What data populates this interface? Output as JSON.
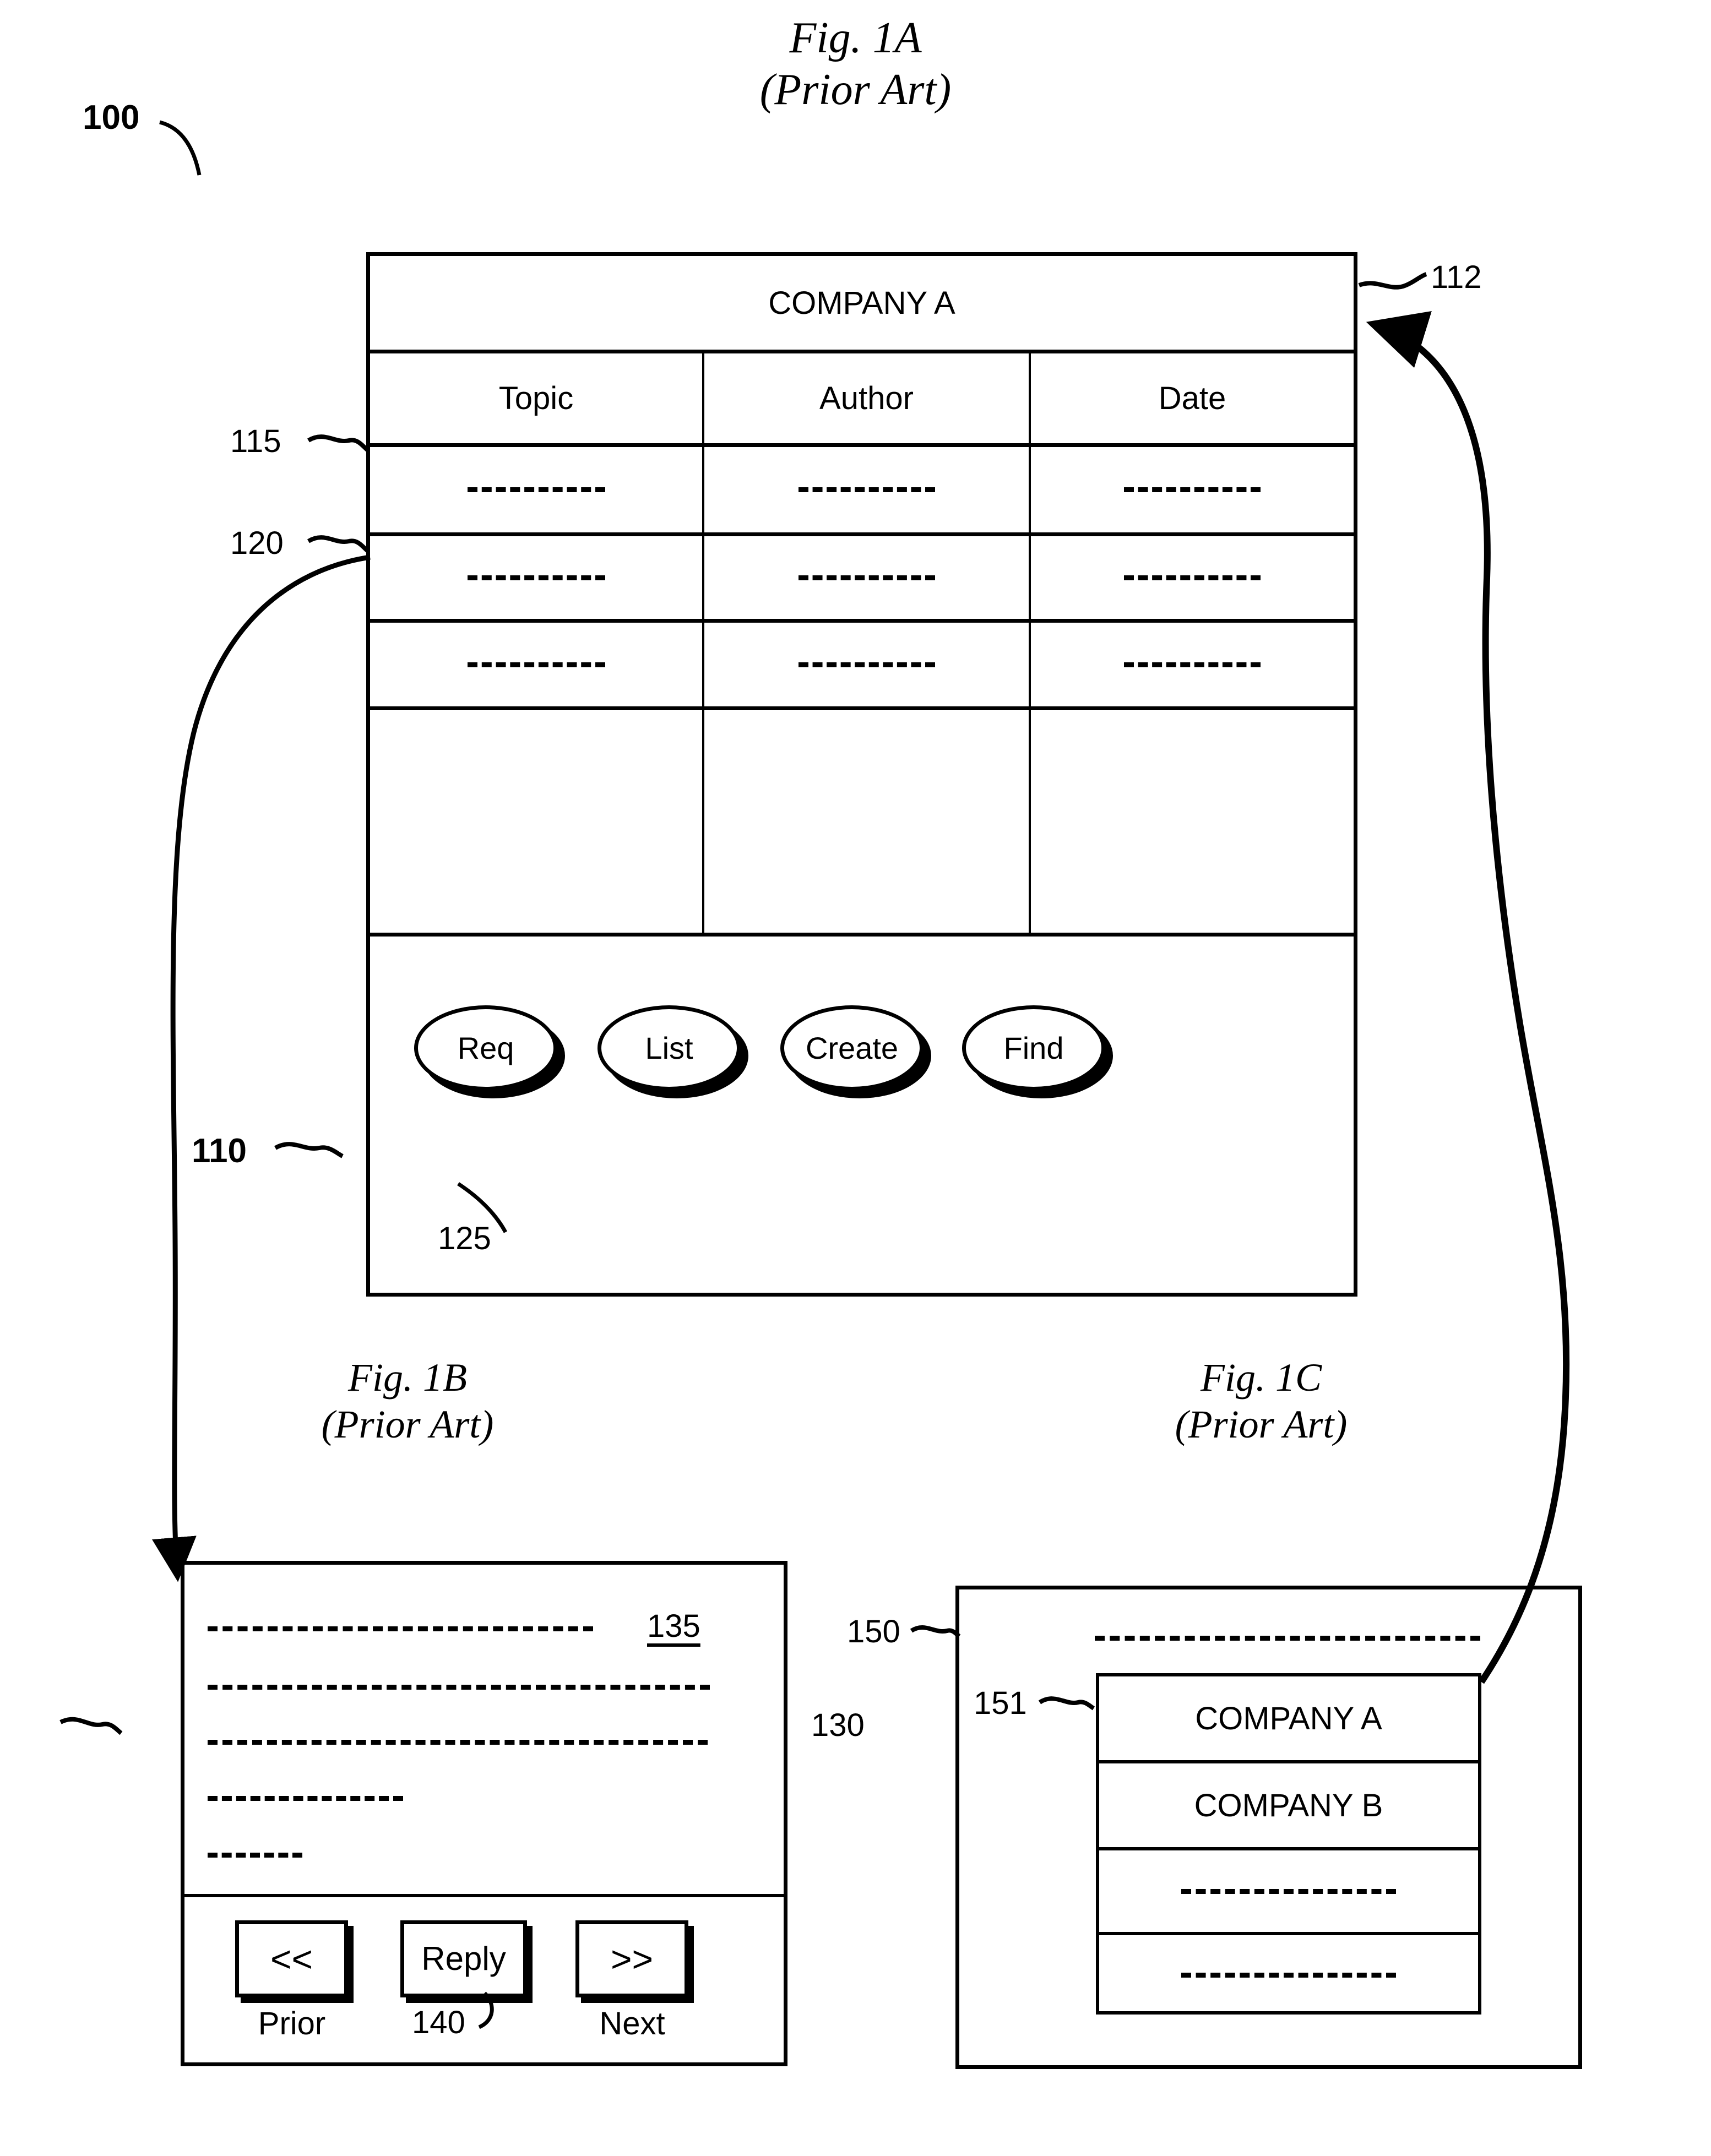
{
  "figures": {
    "fig1a": {
      "title": "Fig. 1A",
      "subtitle": "(Prior Art)"
    },
    "fig1b": {
      "title": "Fig. 1B",
      "subtitle": "(Prior Art)"
    },
    "fig1c": {
      "title": "Fig. 1C",
      "subtitle": "(Prior Art)"
    }
  },
  "fig1a": {
    "company_header": "COMPANY A",
    "columns": [
      "Topic",
      "Author",
      "Date"
    ],
    "data_rows": [
      {
        "topic": "--------------",
        "author": "--------------",
        "date": "--------------"
      },
      {
        "topic": "--------------",
        "author": "--------------",
        "date": "--------------"
      },
      {
        "topic": "--------------",
        "author": "--------------",
        "date": "--------------"
      },
      {
        "topic": "",
        "author": "",
        "date": ""
      }
    ],
    "buttons": [
      "Req",
      "List",
      "Create",
      "Find"
    ],
    "refs": {
      "window": "100",
      "header_bar": "112",
      "column_header_row": "115",
      "data_row": "120",
      "button_bar": "110",
      "button": "125"
    }
  },
  "fig1b": {
    "message_lines": [
      "----------------------------",
      "--------------------------------",
      "--------------------------------",
      "--------------",
      "-------"
    ],
    "message_id": "135",
    "buttons": [
      {
        "glyph": "<<",
        "caption": "Prior"
      },
      {
        "glyph": "Reply",
        "caption": ""
      },
      {
        "glyph": ">>",
        "caption": "Next"
      }
    ],
    "refs": {
      "panel": "130",
      "reply_button": "140"
    }
  },
  "fig1c": {
    "top_placeholder": "------------------------",
    "list_items": [
      "COMPANY A",
      "COMPANY B",
      "----------------------",
      "----------------------"
    ],
    "refs": {
      "panel": "150",
      "list_box": "151"
    }
  },
  "colors": {
    "ink": "#000000",
    "paper": "#ffffff"
  }
}
